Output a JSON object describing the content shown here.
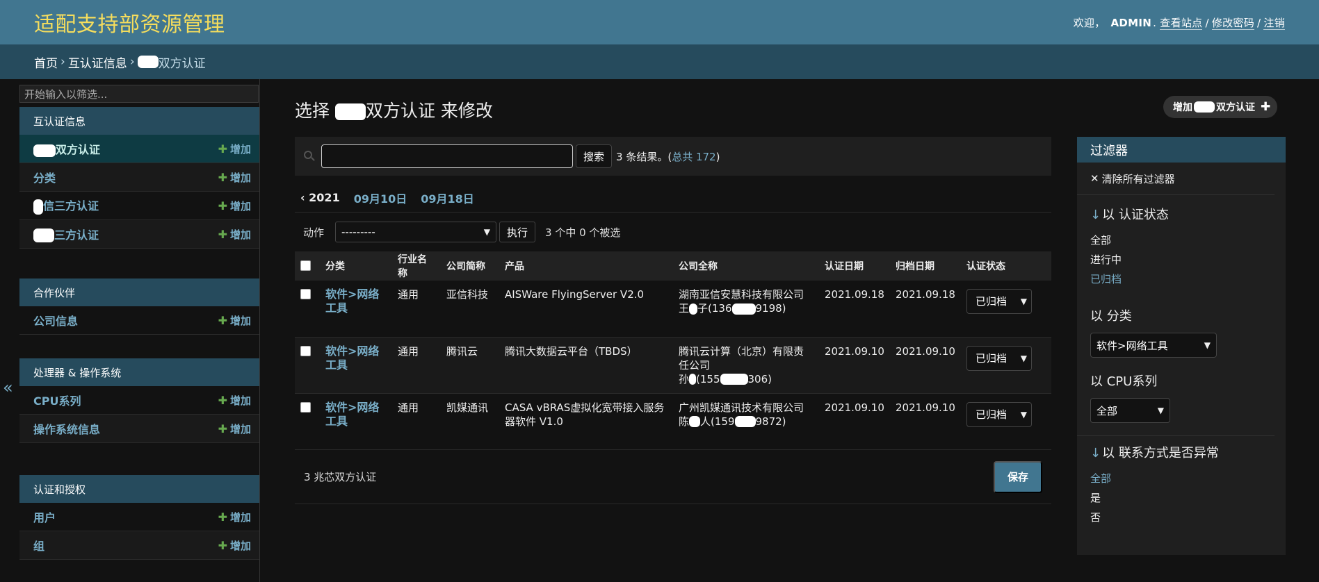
{
  "header": {
    "site_title": "适配支持部资源管理",
    "welcome": "欢迎，",
    "username": "ADMIN",
    "view_site": "查看站点",
    "change_password": "修改密码",
    "logout": "注销"
  },
  "breadcrumbs": {
    "home": "首页",
    "app": "互认证信息",
    "current": "双方认证"
  },
  "sidebar": {
    "filter_placeholder": "开始输入以筛选...",
    "add_label": "增加",
    "modules": [
      {
        "caption": "互认证信息",
        "rows": [
          {
            "label": "双方认证"
          },
          {
            "label": "分类"
          },
          {
            "label": "信三方认证"
          },
          {
            "label": "三方认证"
          }
        ]
      },
      {
        "caption": "合作伙伴",
        "rows": [
          {
            "label": "公司信息"
          }
        ]
      },
      {
        "caption": "处理器 & 操作系统",
        "rows": [
          {
            "label": "CPU系列"
          },
          {
            "label": "操作系统信息"
          }
        ]
      },
      {
        "caption": "认证和授权",
        "rows": [
          {
            "label": "用户"
          },
          {
            "label": "组"
          }
        ]
      }
    ],
    "collapse_icon": "«"
  },
  "content": {
    "title_prefix": "选择",
    "title_suffix": "双方认证 来修改",
    "add_button_prefix": "增加",
    "add_button_suffix": "双方认证"
  },
  "search": {
    "value": "",
    "button": "搜索",
    "result_text": "3 条结果。(",
    "total_link": "总共 172",
    "result_close": ")"
  },
  "date_hierarchy": {
    "back": "‹ 2021",
    "links": [
      "09月10日",
      "09月18日"
    ]
  },
  "actions": {
    "label": "动作",
    "selected": "---------",
    "go": "执行",
    "counter": "3 个中 0 个被选"
  },
  "table": {
    "headers": [
      "分类",
      "行业名称",
      "公司简称",
      "产品",
      "公司全称",
      "认证日期",
      "归档日期",
      "认证状态"
    ],
    "rows": [
      {
        "category": "软件>网络工具",
        "industry": "通用",
        "short_name": "亚信科技",
        "product": "AISWare FlyingServer V2.0",
        "full_name": "湖南亚信安慧科技有限公司",
        "contact_a": "王",
        "contact_b": "子(136",
        "contact_c": "9198)",
        "cert_date": "2021.09.18",
        "archive_date": "2021.09.18",
        "status": "已归档"
      },
      {
        "category": "软件>网络工具",
        "industry": "通用",
        "short_name": "腾讯云",
        "product": "腾讯大数据云平台（TBDS）",
        "full_name": "腾讯云计算（北京）有限责任公司",
        "contact_a": "孙",
        "contact_b": "(155",
        "contact_c": "306)",
        "cert_date": "2021.09.10",
        "archive_date": "2021.09.10",
        "status": "已归档"
      },
      {
        "category": "软件>网络工具",
        "industry": "通用",
        "short_name": "凯媒通讯",
        "product": "CASA vBRAS虚拟化宽带接入服务器软件 V1.0",
        "full_name": "广州凯媒通讯技术有限公司",
        "contact_a": "陈",
        "contact_b": "人(159",
        "contact_c": "9872)",
        "cert_date": "2021.09.10",
        "archive_date": "2021.09.10",
        "status": "已归档"
      }
    ]
  },
  "paginator": {
    "count_text": "3 兆芯双方认证",
    "save": "保存"
  },
  "filter": {
    "heading": "过滤器",
    "clear": "清除所有过滤器",
    "sections": {
      "status": {
        "title": "以 认证状态",
        "options": [
          "全部",
          "进行中",
          "已归档"
        ],
        "selected_index": 2
      },
      "category": {
        "title": "以 分类",
        "selected": "软件>网络工具"
      },
      "cpu": {
        "title": "以 CPU系列",
        "selected": "全部"
      },
      "contact": {
        "title": "以 联系方式是否异常",
        "options": [
          "全部",
          "是",
          "否"
        ],
        "selected_index": 0
      }
    }
  },
  "colors": {
    "header_bg": "#417690",
    "breadcrumb_bg": "#264b5d",
    "site_title": "#f5dd5d",
    "link": "#79aec8",
    "add_plus": "#67a94f"
  }
}
